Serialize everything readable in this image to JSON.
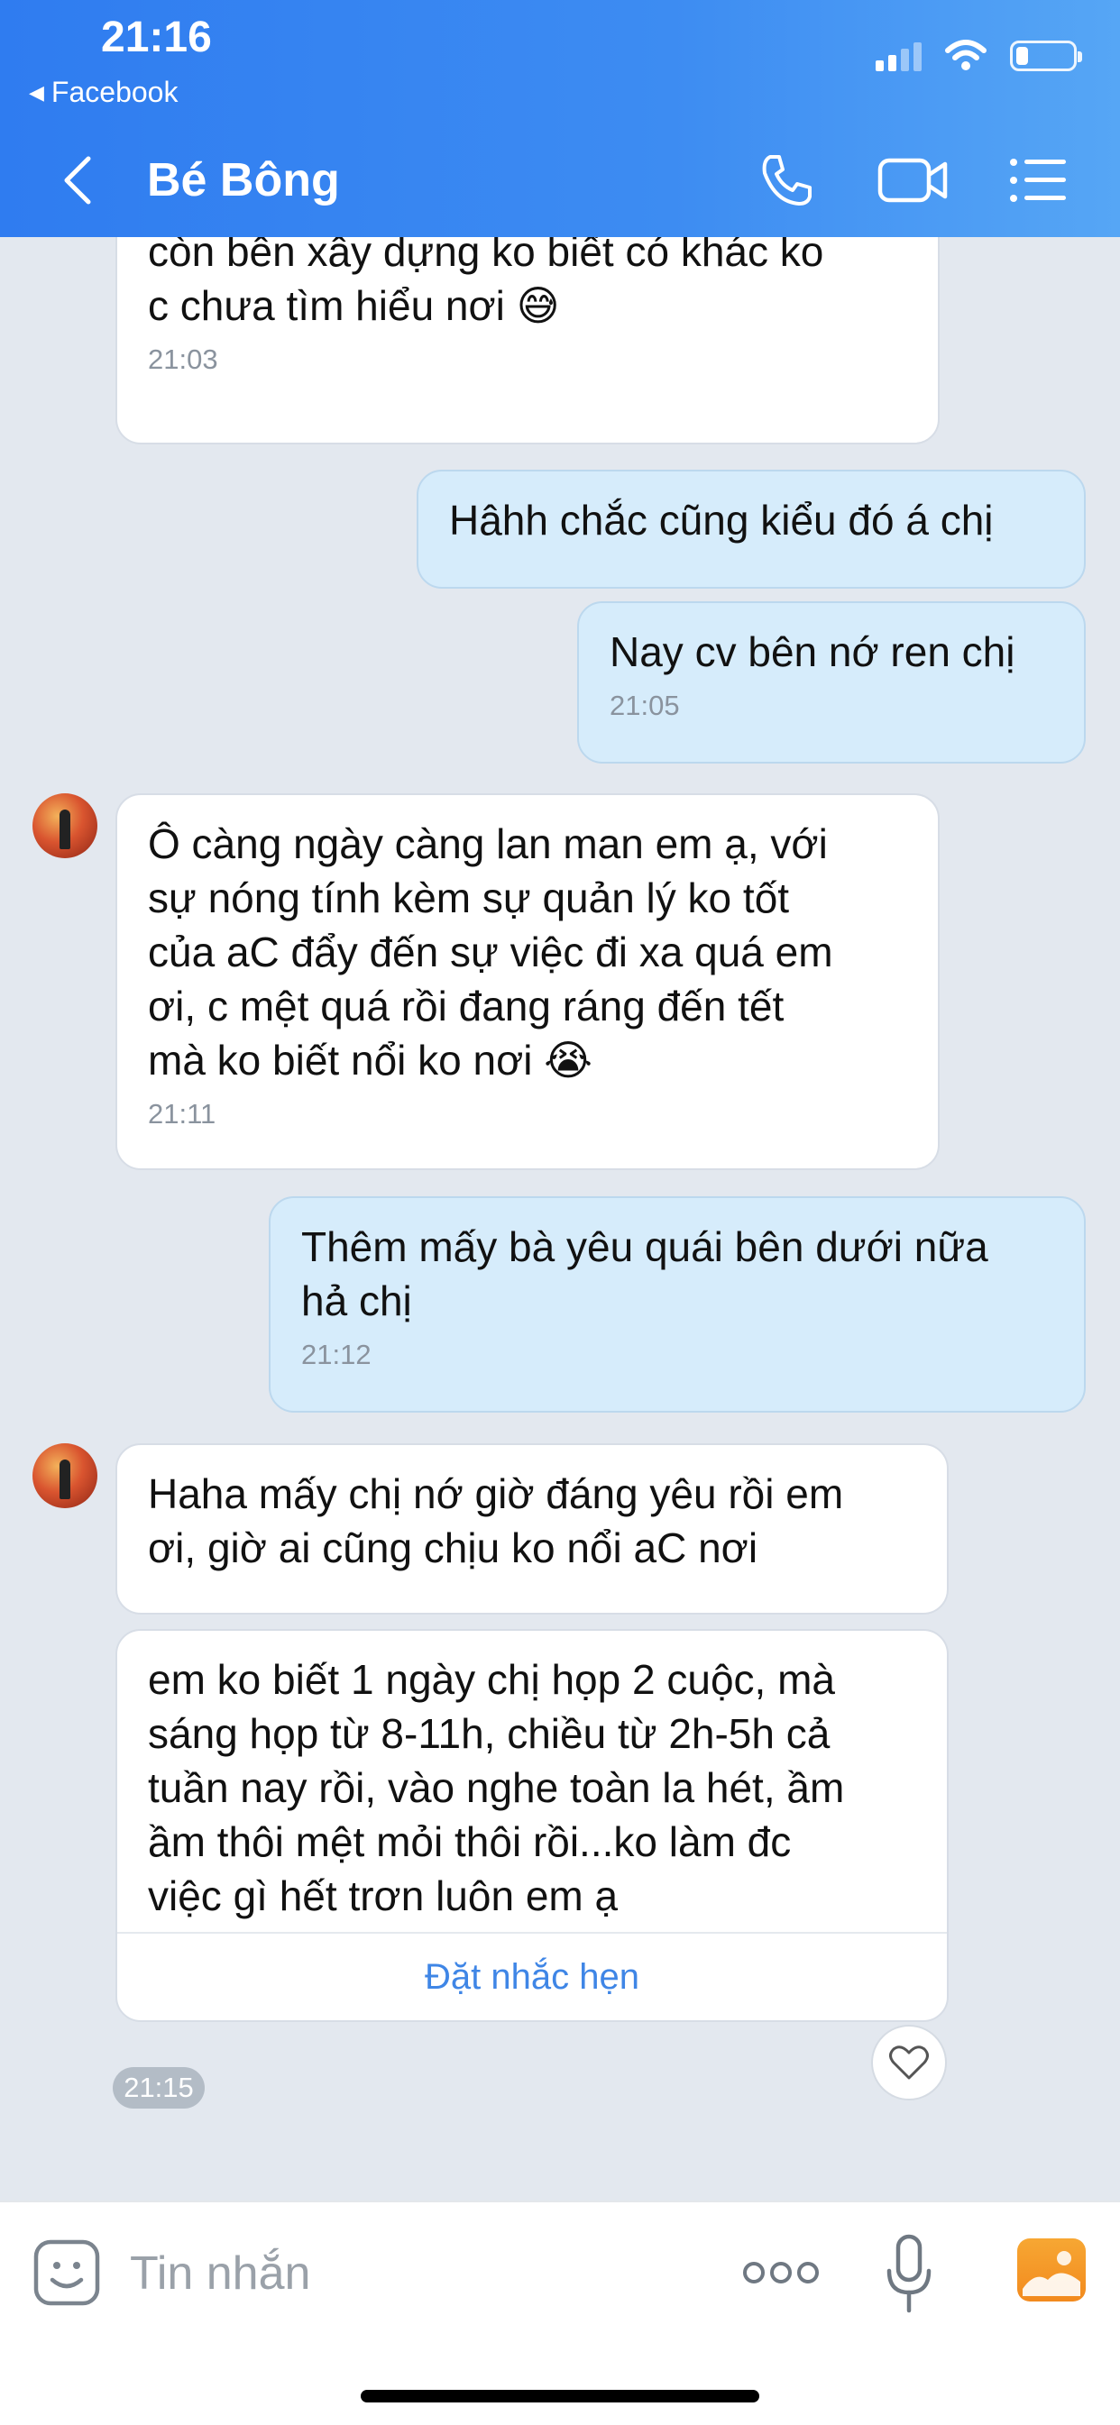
{
  "status_bar": {
    "time": "21:16",
    "back_app": "Facebook"
  },
  "header": {
    "contact_name": "Bé Bông"
  },
  "messages": [
    {
      "side": "in",
      "text": "c mới làm hs thầu của dự án CNTT\ncòn bên xây dựng ko biết có khác ko\nc chưa tìm hiểu nơi 😅",
      "time": "21:03"
    },
    {
      "side": "out",
      "text": "Hâhh chắc cũng kiểu đó á chị",
      "time": ""
    },
    {
      "side": "out",
      "text": "Nay cv bên nớ ren chị",
      "time": "21:05"
    },
    {
      "side": "in",
      "text": "Ô càng ngày càng lan man em ạ, với\nsự nóng tính kèm sự quản lý ko tốt\ncủa aC đẩy đến sự việc đi xa quá em\nơi, c mệt quá rồi đang ráng đến tết\nmà ko biết nổi ko nơi 😭",
      "time": "21:11"
    },
    {
      "side": "out",
      "text": "Thêm mấy bà yêu quái bên dưới nữa\nhả chị",
      "time": "21:12"
    },
    {
      "side": "in",
      "text": "Haha mấy chị nớ giờ đáng yêu rồi em\nơi, giờ ai cũng chịu ko nổi aC nơi",
      "time": ""
    },
    {
      "side": "in",
      "text": "em ko biết 1 ngày chị họp 2 cuộc, mà\nsáng họp từ 8-11h, chiều từ 2h-5h cả\ntuần nay rồi, vào nghe toàn la hét, ầm\nầm thôi mệt mỏi thôi rồi...ko làm đc\nviệc gì hết trơn luôn em ạ",
      "time": "",
      "action": "Đặt nhắc hẹn"
    }
  ],
  "last_time": "21:15",
  "input": {
    "placeholder": "Tin nhắn"
  },
  "colors": {
    "header_blue": "#3d8cf2",
    "outgoing_bubble": "#d6ecfb",
    "incoming_bubble": "#ffffff",
    "link_blue": "#3f86e6",
    "gallery_orange": "#f28a1e"
  }
}
